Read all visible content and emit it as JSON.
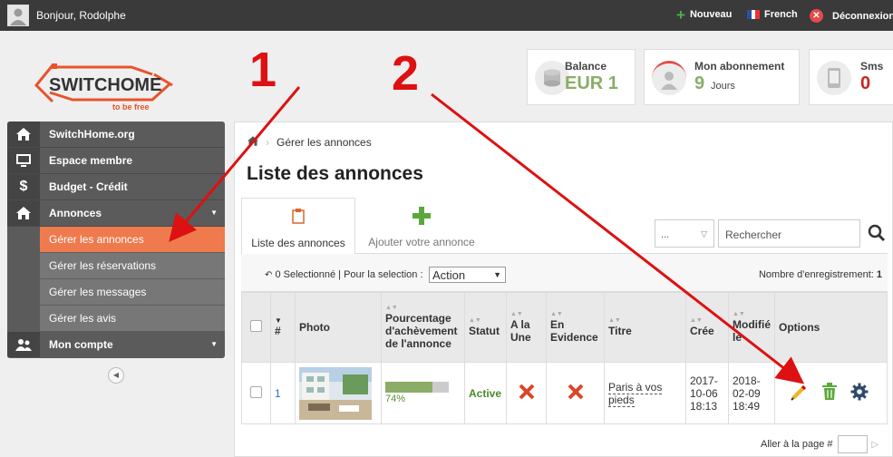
{
  "topbar": {
    "greeting": "Bonjour, Rodolphe",
    "nouveau": "Nouveau",
    "language": "French",
    "logout": "Déconnexion",
    "avatar_icon": "user-avatar-icon"
  },
  "logo": {
    "name": "SWITCHOME",
    "tagline": "to be free"
  },
  "cards": {
    "balance": {
      "label": "Balance",
      "value": "EUR 1",
      "icon": "coins-icon",
      "color": "#8bad68"
    },
    "abonnement": {
      "label": "Mon abonnement",
      "value": "9",
      "unit": "Jours",
      "icon": "user-icon",
      "color": "#8bad68"
    },
    "sms": {
      "label": "Sms",
      "value": "0",
      "icon": "phone-icon",
      "color": "#cc2222"
    }
  },
  "sidebar": {
    "items": [
      {
        "label": "SwitchHome.org",
        "icon": "home-icon"
      },
      {
        "label": "Espace membre",
        "icon": "monitor-icon"
      },
      {
        "label": "Budget - Crédit",
        "icon": "dollar-icon"
      },
      {
        "label": "Annonces",
        "icon": "home-icon"
      }
    ],
    "subitems": [
      "Gérer les annonces",
      "Gérer les réservations",
      "Gérer les messages",
      "Gérer les avis"
    ],
    "account": {
      "label": "Mon compte",
      "icon": "users-icon"
    }
  },
  "breadcrumb": {
    "current": "Gérer les annonces"
  },
  "page_title": "Liste des annonces",
  "tabs": [
    {
      "label": "Liste des annonces",
      "icon": "clipboard-icon"
    },
    {
      "label": "Ajouter votre annonce",
      "icon": "plus-icon"
    }
  ],
  "filter": {
    "select_value": "...",
    "search_placeholder": "Rechercher"
  },
  "toolbar": {
    "selection": "0 Selectionné | Pour la selection :",
    "action": "Action",
    "count_label": "Nombre d'enregistrement:",
    "count": "1"
  },
  "table": {
    "headers": {
      "num": "#",
      "photo": "Photo",
      "pct": "Pourcentage d'achèvement de l'annonce",
      "statut": "Statut",
      "aune": "A la Une",
      "evidence": "En Evidence",
      "titre": "Titre",
      "cree": "Crée",
      "modifie": "Modifié le",
      "options": "Options"
    },
    "rows": [
      {
        "num": "1",
        "progress": 74,
        "progress_label": "74%",
        "statut": "Active",
        "titre": "Paris à vos pieds",
        "cree": "2017-10-06 18:13",
        "modifie": "2018-02-09 18:49"
      }
    ]
  },
  "pager": {
    "label": "Aller à la page #"
  },
  "annotations": {
    "n1": "1",
    "n2": "2",
    "color": "#dd1111"
  },
  "colors": {
    "accent": "#ef7a4e",
    "green": "#8bad68",
    "red": "#e54b4b"
  }
}
